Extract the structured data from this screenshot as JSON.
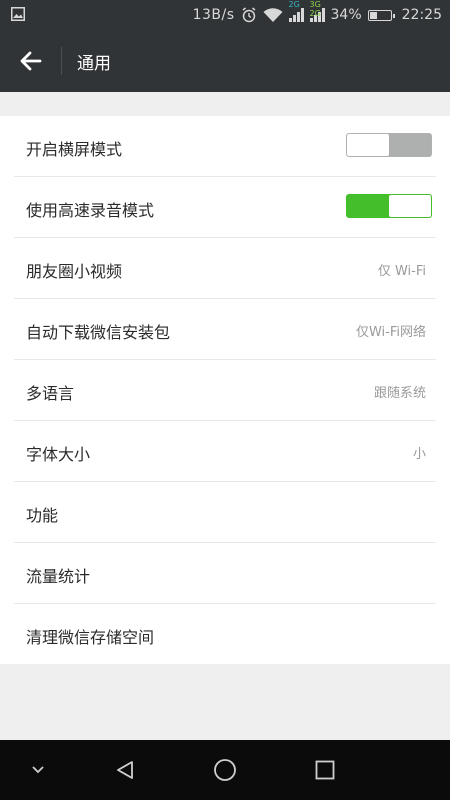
{
  "status_bar": {
    "network_speed": "13B/s",
    "net_tag_1": "2G",
    "net_tag_2": "3G 2G",
    "battery": "34%",
    "time": "22:25",
    "icons": [
      "image-icon",
      "alarm-icon",
      "wifi-icon",
      "signal-icon",
      "battery-icon"
    ]
  },
  "app_bar": {
    "title": "通用",
    "back_icon": "arrow-left-icon"
  },
  "settings": [
    {
      "label": "开启横屏模式",
      "type": "toggle",
      "on": false
    },
    {
      "label": "使用高速录音模式",
      "type": "toggle",
      "on": true
    },
    {
      "label": "朋友圈小视频",
      "type": "value",
      "value": "仅 Wi-Fi"
    },
    {
      "label": "自动下载微信安装包",
      "type": "value",
      "value": "仅Wi-Fi网络"
    },
    {
      "label": "多语言",
      "type": "value",
      "value": "跟随系统"
    },
    {
      "label": "字体大小",
      "type": "value",
      "value": "小"
    },
    {
      "label": "功能",
      "type": "link"
    },
    {
      "label": "流量统计",
      "type": "link"
    },
    {
      "label": "清理微信存储空间",
      "type": "link"
    }
  ],
  "colors": {
    "toggle_on": "#44be2a",
    "toggle_off": "#aeb0af",
    "app_bar": "#303436"
  },
  "nav_bar": {
    "icons": [
      "chevron-down-icon",
      "back-triangle-icon",
      "home-circle-icon",
      "recents-square-icon"
    ]
  }
}
